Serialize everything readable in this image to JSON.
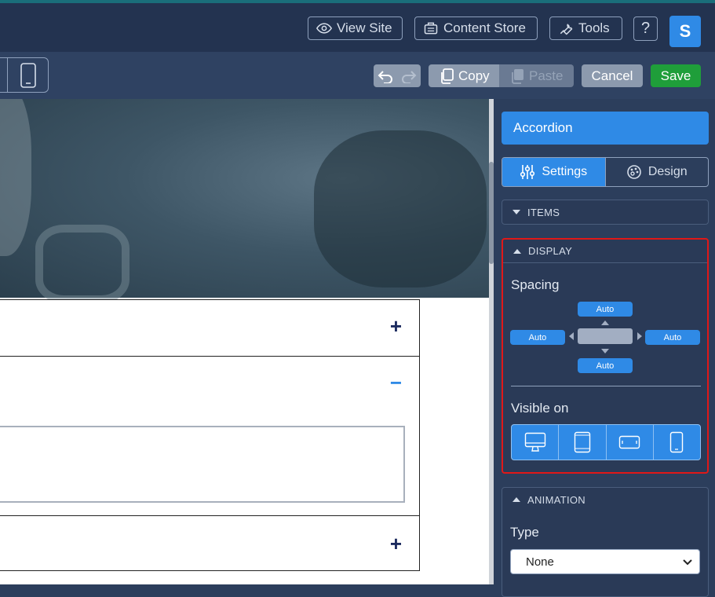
{
  "topbar": {
    "view_site": "View Site",
    "content_store": "Content Store",
    "tools": "Tools",
    "help": "?",
    "avatar": "S"
  },
  "toolbar": {
    "copy": "Copy",
    "paste": "Paste",
    "cancel": "Cancel",
    "save": "Save"
  },
  "panel": {
    "title": "Accordion",
    "tabs": [
      "Settings",
      "Design"
    ],
    "sections": {
      "items": "ITEMS",
      "display": "DISPLAY",
      "animation": "ANIMATION"
    },
    "spacing_label": "Spacing",
    "spacing": {
      "top": "Auto",
      "left": "Auto",
      "right": "Auto",
      "bottom": "Auto"
    },
    "visible_on_label": "Visible on",
    "type_label": "Type",
    "type_value": "None"
  },
  "accordion": {
    "items": [
      {
        "icon": "+"
      },
      {
        "icon": "−"
      },
      {
        "icon": "+"
      }
    ]
  },
  "colors": {
    "accent": "#2f8ae6",
    "save": "#1f9e3a",
    "highlight": "#e01818",
    "plus": "#1b2a5e",
    "minus": "#2f8ae6"
  }
}
